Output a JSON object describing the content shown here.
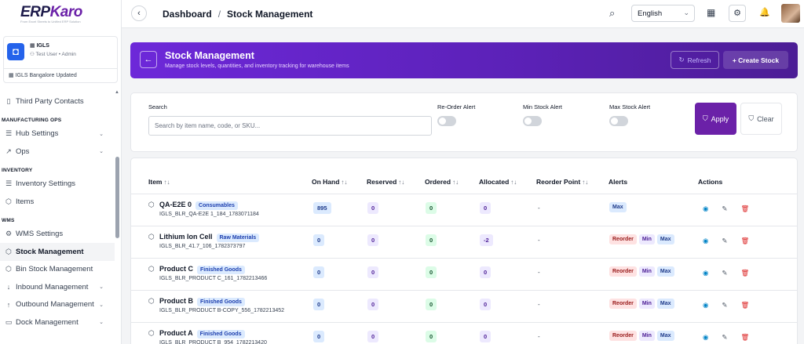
{
  "sidebar": {
    "logo": {
      "brand_a": "ERP",
      "brand_b": "Karo",
      "tagline": "From Excel Sheets to Unified ERP Solution"
    },
    "org": {
      "name": "IGLS",
      "user": "Test User • Admin",
      "branch": "IGLS Bangalore Updated"
    },
    "items": [
      {
        "type": "item",
        "label": "Third Party Contacts",
        "icon": "contacts-icon",
        "glyph": "▯"
      },
      {
        "type": "section",
        "label": "MANUFACTURING OPS"
      },
      {
        "type": "item",
        "label": "Hub Settings",
        "icon": "sliders-icon",
        "glyph": "☰",
        "chevron": true
      },
      {
        "type": "item",
        "label": "Ops",
        "icon": "chart-icon",
        "glyph": "↗",
        "chevron": true
      },
      {
        "type": "section",
        "label": "INVENTORY"
      },
      {
        "type": "item",
        "label": "Inventory Settings",
        "icon": "sliders-icon",
        "glyph": "☰"
      },
      {
        "type": "item",
        "label": "Items",
        "icon": "box-icon",
        "glyph": "⬡"
      },
      {
        "type": "section",
        "label": "WMS"
      },
      {
        "type": "item",
        "label": "WMS Settings",
        "icon": "gear-icon",
        "glyph": "⚙"
      },
      {
        "type": "item",
        "label": "Stock Management",
        "icon": "box-icon",
        "glyph": "⬡",
        "active": true
      },
      {
        "type": "item",
        "label": "Bin Stock Management",
        "icon": "box-icon",
        "glyph": "⬡"
      },
      {
        "type": "item",
        "label": "Inbound Management",
        "icon": "arrow-down-icon",
        "glyph": "↓",
        "chevron": true
      },
      {
        "type": "item",
        "label": "Outbound Management",
        "icon": "arrow-up-icon",
        "glyph": "↑",
        "chevron": true
      },
      {
        "type": "item",
        "label": "Dock Management",
        "icon": "truck-icon",
        "glyph": "▭",
        "chevron": true
      }
    ]
  },
  "header": {
    "crumb_1": "Dashboard",
    "crumb_sep": "/",
    "crumb_2": "Stock Management",
    "language": "English"
  },
  "banner": {
    "title": "Stock Management",
    "subtitle": "Manage stock levels, quantities, and inventory tracking for warehouse items",
    "refresh_label": "Refresh",
    "create_label": "+ Create Stock"
  },
  "filters": {
    "search_label": "Search",
    "search_placeholder": "Search by item name, code, or SKU...",
    "reorder_label": "Re-Order Alert",
    "min_label": "Min Stock Alert",
    "max_label": "Max Stock Alert",
    "apply_label": "Apply",
    "clear_label": "Clear"
  },
  "table": {
    "columns": [
      "Item",
      "On Hand",
      "Reserved",
      "Ordered",
      "Allocated",
      "Reorder Point",
      "Alerts",
      "Actions"
    ],
    "sort_glyph": "↑↓",
    "rows": [
      {
        "name": "QA-E2E 0",
        "category": "Consumables",
        "code": "IGLS_BLR_QA-E2E 1_184_1783071184",
        "on_hand": "895",
        "reserved": "0",
        "ordered": "0",
        "allocated": "0",
        "reorder_point": "-",
        "alerts": [
          "Max"
        ]
      },
      {
        "name": "Lithium Ion Cell",
        "category": "Raw Materials",
        "code": "IGLS_BLR_41.7_106_1782373797",
        "on_hand": "0",
        "reserved": "0",
        "ordered": "0",
        "allocated": "-2",
        "reorder_point": "-",
        "alerts": [
          "Reorder",
          "Min",
          "Max"
        ]
      },
      {
        "name": "Product C",
        "category": "Finished Goods",
        "code": "IGLS_BLR_PRODUCT C_161_1782213466",
        "on_hand": "0",
        "reserved": "0",
        "ordered": "0",
        "allocated": "0",
        "reorder_point": "-",
        "alerts": [
          "Reorder",
          "Min",
          "Max"
        ]
      },
      {
        "name": "Product B",
        "category": "Finished Goods",
        "code": "IGLS_BLR_PRODUCT B-COPY_556_1782213452",
        "on_hand": "0",
        "reserved": "0",
        "ordered": "0",
        "allocated": "0",
        "reorder_point": "-",
        "alerts": [
          "Reorder",
          "Min",
          "Max"
        ]
      },
      {
        "name": "Product A",
        "category": "Finished Goods",
        "code": "IGLS_BLR_PRODUCT B_954_1782213420",
        "on_hand": "0",
        "reserved": "0",
        "ordered": "0",
        "allocated": "0",
        "reorder_point": "-",
        "alerts": [
          "Reorder",
          "Min",
          "Max"
        ]
      }
    ]
  },
  "colors": {
    "accent": "#6b21a8",
    "banner": "#5b21b6"
  }
}
